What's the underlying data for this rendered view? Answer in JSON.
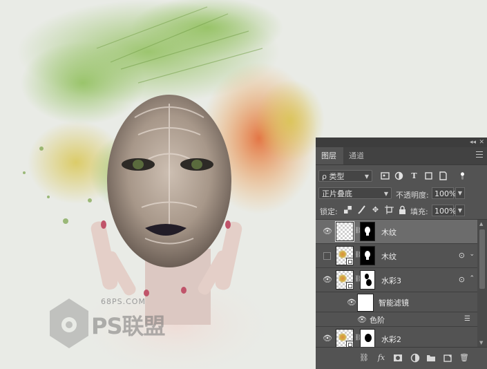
{
  "panel": {
    "tabs": [
      {
        "label": "图层",
        "active": true
      },
      {
        "label": "通道",
        "active": false
      }
    ],
    "filter": {
      "kind_label": "ρ 类型",
      "icons": [
        "image-filter-icon",
        "adjustment-filter-icon",
        "type-filter-icon",
        "shape-filter-icon",
        "smart-object-filter-icon",
        "filter-toggle-icon"
      ]
    },
    "blend": {
      "mode": "正片叠底",
      "opacity_label": "不透明度:",
      "opacity_value": "100%"
    },
    "lock": {
      "label": "锁定:",
      "fill_label": "填充:",
      "fill_value": "100%"
    },
    "layers": [
      {
        "name": "木纹",
        "visible": true,
        "selected": true,
        "smart_object": false,
        "has_fx": false
      },
      {
        "name": "木纹",
        "visible": false,
        "selected": false,
        "smart_object": true,
        "has_fx": true
      },
      {
        "name": "水彩3",
        "visible": true,
        "selected": false,
        "smart_object": true,
        "has_fx": true,
        "expanded": true
      },
      {
        "name": "水彩2",
        "visible": true,
        "selected": false,
        "smart_object": true,
        "has_fx": false
      }
    ],
    "smart_filters_label": "智能滤镜",
    "levels_label": "色阶"
  },
  "watermark": {
    "site": "68PS.COM",
    "name": "PS联盟"
  },
  "colors": {
    "panel_bg": "#535353",
    "selected_row": "#6c6c6c",
    "canvas_bg": "#e9ebe6"
  }
}
